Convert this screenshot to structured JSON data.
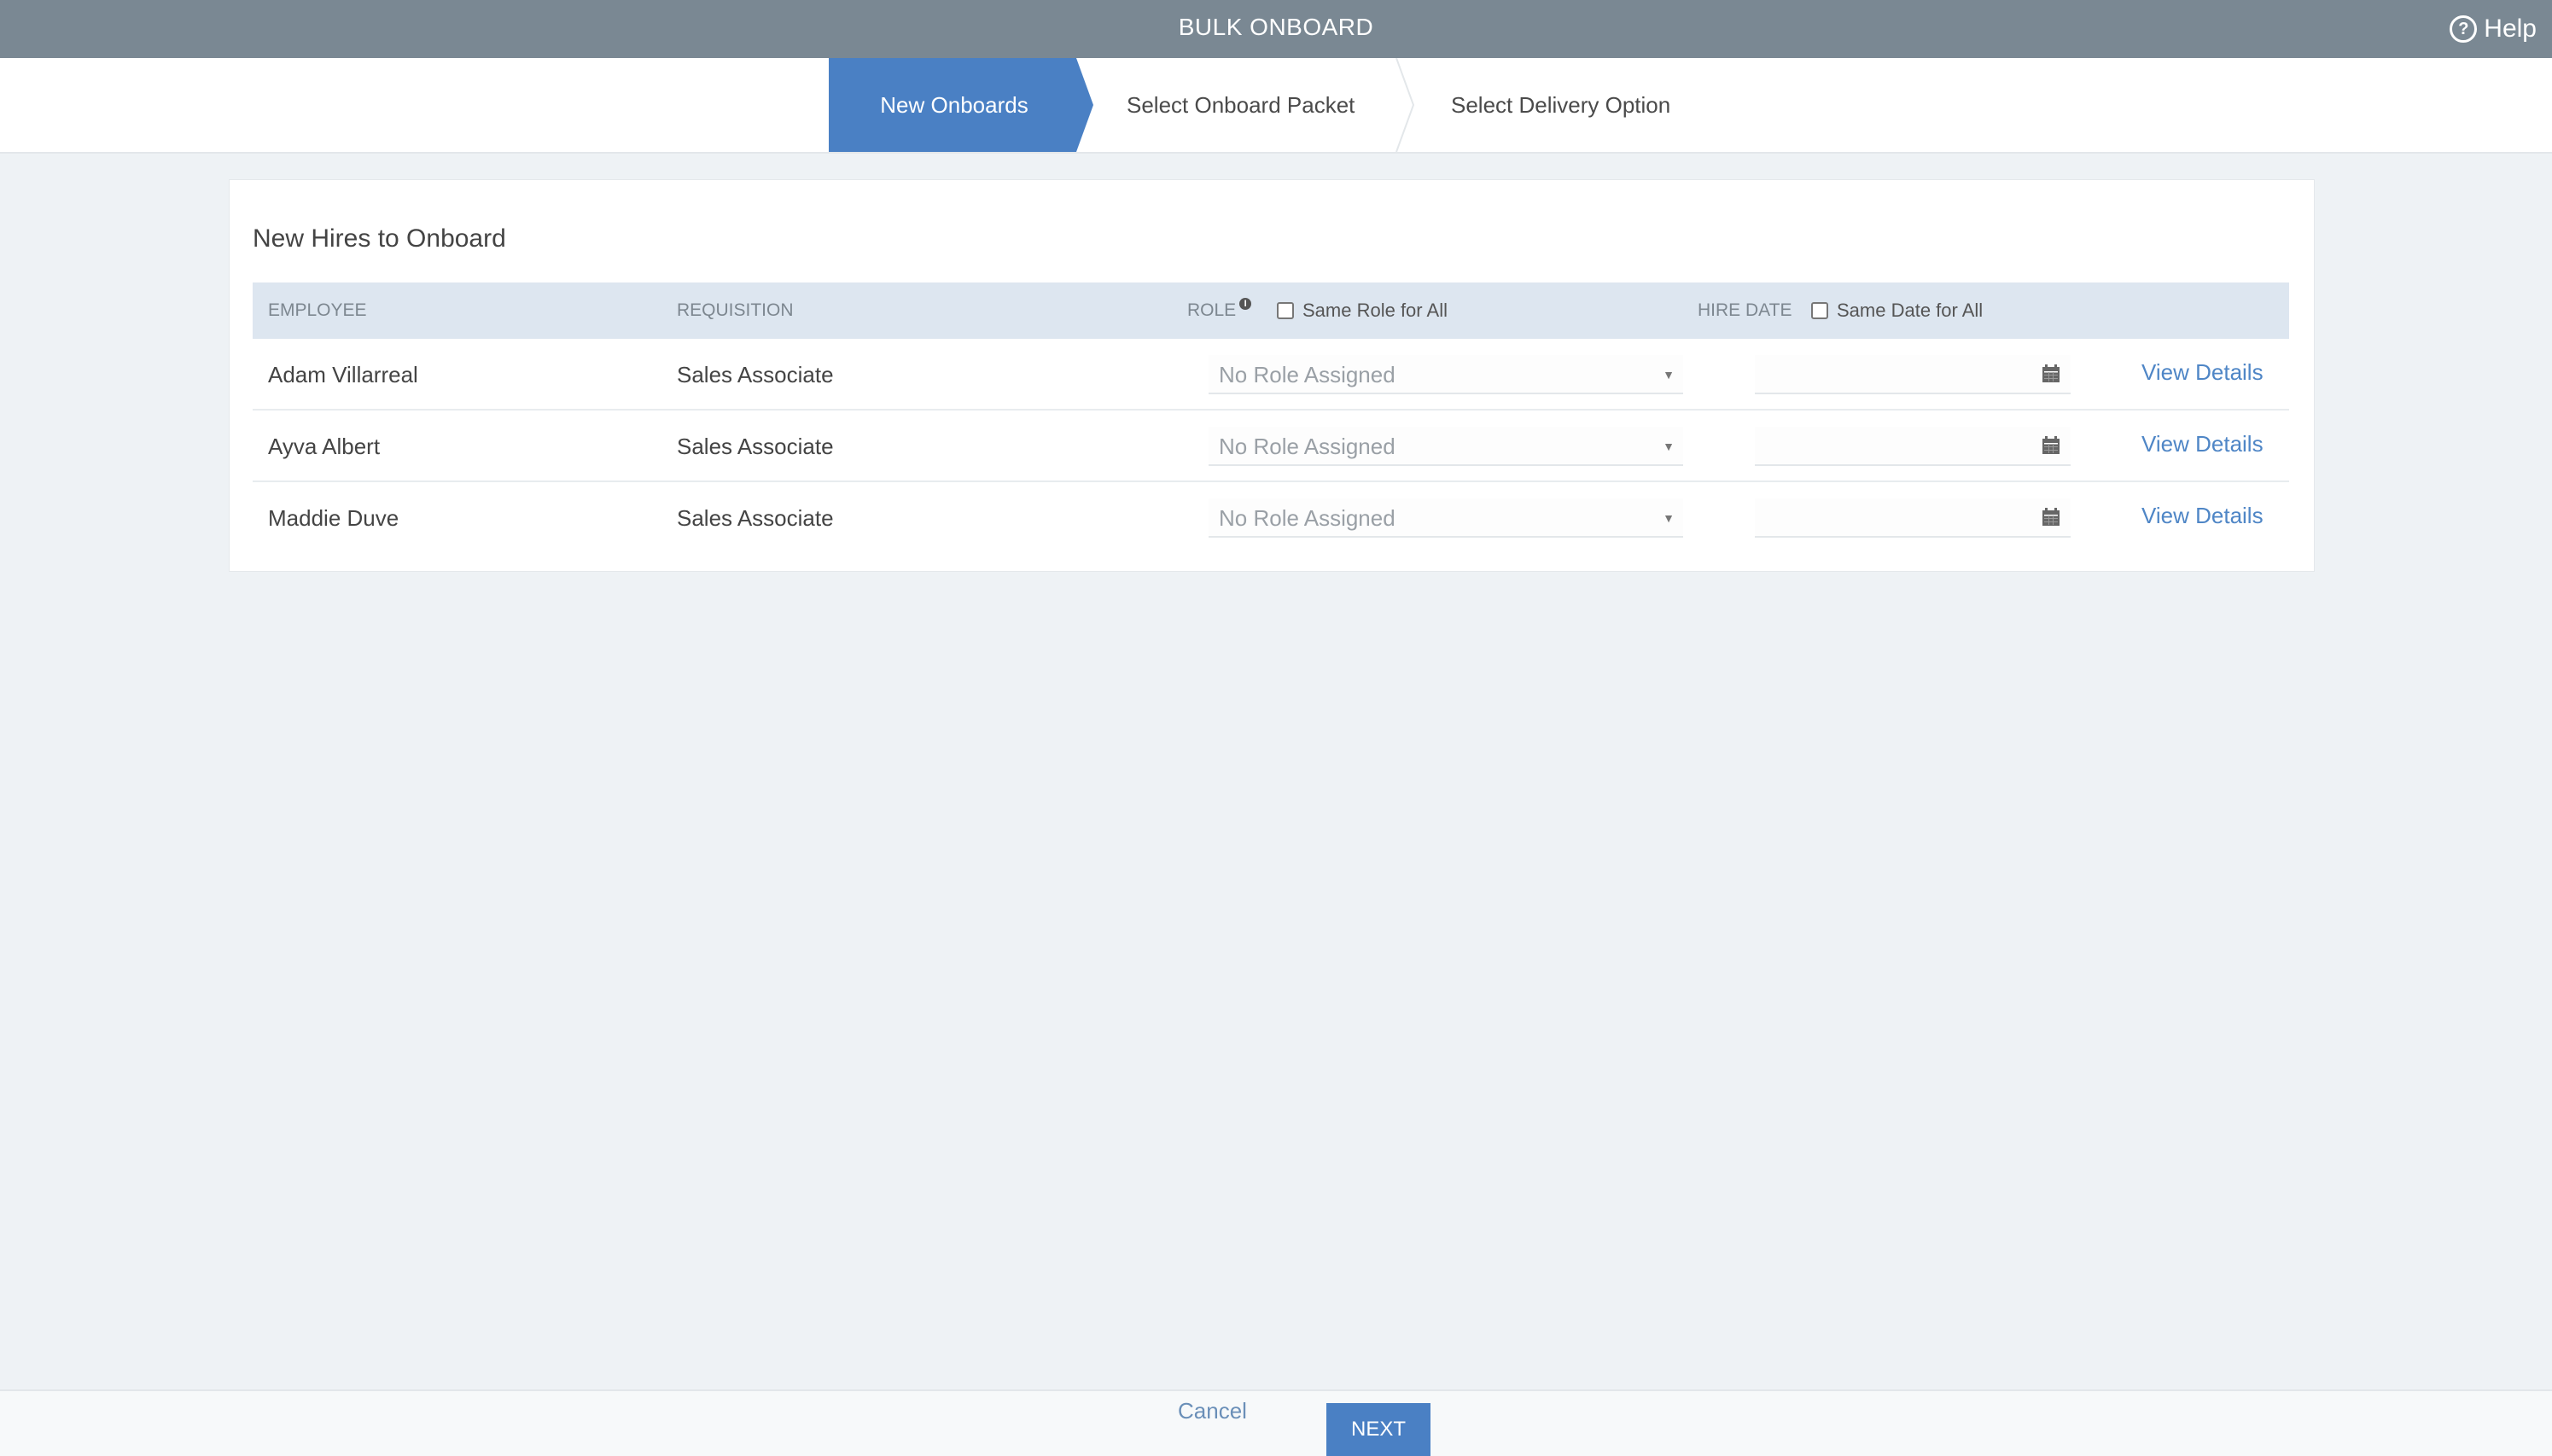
{
  "header": {
    "title": "BULK ONBOARD",
    "help_label": "Help",
    "help_icon": "question-circle-icon"
  },
  "steps": [
    {
      "label": "New Onboards",
      "active": true
    },
    {
      "label": "Select Onboard Packet",
      "active": false
    },
    {
      "label": "Select Delivery Option",
      "active": false
    }
  ],
  "colors": {
    "topbar": "#7a8893",
    "active_step": "#4a80c4",
    "table_header": "#dde6f0",
    "link": "#4f86c6",
    "background": "#eef2f5"
  },
  "card": {
    "title": "New Hires to Onboard",
    "columns": {
      "employee": "EMPLOYEE",
      "requisition": "REQUISITION",
      "role": "ROLE",
      "role_checkbox_label": "Same Role for All",
      "hire_date": "HIRE DATE",
      "date_checkbox_label": "Same Date for All"
    },
    "rows": [
      {
        "employee": "Adam Villarreal",
        "requisition": "Sales Associate",
        "role": "No Role Assigned",
        "hire_date": "",
        "action": "View Details"
      },
      {
        "employee": "Ayva Albert",
        "requisition": "Sales Associate",
        "role": "No Role Assigned",
        "hire_date": "",
        "action": "View Details"
      },
      {
        "employee": "Maddie Duve",
        "requisition": "Sales Associate",
        "role": "No Role Assigned",
        "hire_date": "",
        "action": "View Details"
      }
    ]
  },
  "footer": {
    "cancel_label": "Cancel",
    "next_label": "NEXT"
  }
}
